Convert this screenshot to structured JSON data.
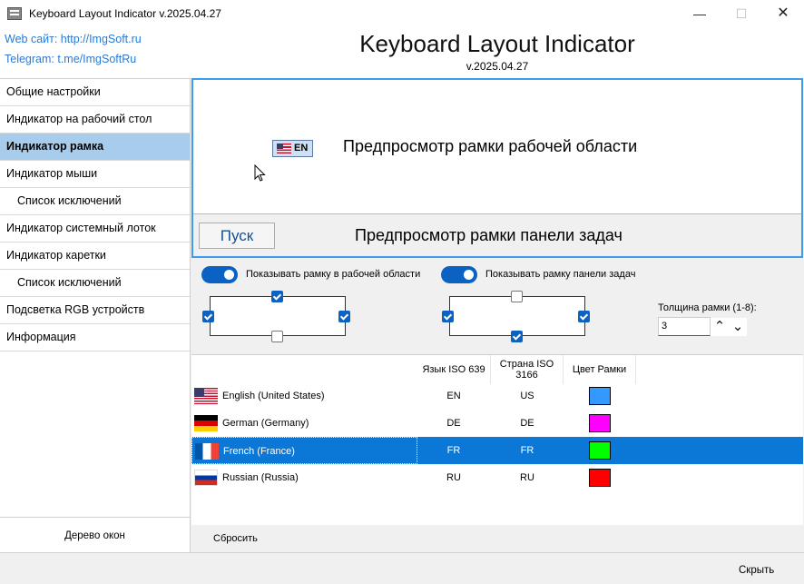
{
  "window": {
    "title": "Keyboard Layout Indicator v.2025.04.27",
    "minimize": "—",
    "maximize": "☐",
    "close": "✕"
  },
  "header": {
    "web_link": "Web сайт: http://ImgSoft.ru",
    "telegram_link": "Telegram: t.me/ImgSoftRu",
    "title": "Keyboard Layout Indicator",
    "version": "v.2025.04.27"
  },
  "sidebar": {
    "items": [
      {
        "label": "Общие настройки"
      },
      {
        "label": "Индикатор на рабочий стол"
      },
      {
        "label": "Индикатор рамка"
      },
      {
        "label": "Индикатор мыши"
      },
      {
        "label": "Список исключений"
      },
      {
        "label": "Индикатор системный лоток"
      },
      {
        "label": "Индикатор каретки"
      },
      {
        "label": "Список исключений"
      },
      {
        "label": "Подсветка RGB устройств"
      },
      {
        "label": "Информация"
      }
    ],
    "active_index": 2,
    "tree_button": "Дерево окон"
  },
  "preview": {
    "workspace_label": "Предпросмотр рамки рабочей области",
    "badge_text": "EN",
    "start_button": "Пуск",
    "taskbar_label": "Предпросмотр рамки панели задач"
  },
  "options": {
    "show_workspace_frame": {
      "label": "Показывать рамку в рабочей области",
      "on": true
    },
    "show_taskbar_frame": {
      "label": "Показывать рамку панели задач",
      "on": true
    },
    "workspace_sides": {
      "top": true,
      "left": true,
      "right": true,
      "bottom": false
    },
    "taskbar_sides": {
      "top": false,
      "left": true,
      "right": true,
      "bottom": true
    },
    "thickness_label": "Толщина рамки (1-8):",
    "thickness_value": "3"
  },
  "table": {
    "columns": {
      "iso639": "Язык ISO 639",
      "iso3166": "Страна ISO 3166",
      "color": "Цвет Рамки"
    },
    "rows": [
      {
        "name": "English (United States)",
        "iso639": "EN",
        "iso3166": "US",
        "color": "#3399ff",
        "flag": "us-flag"
      },
      {
        "name": "German (Germany)",
        "iso639": "DE",
        "iso3166": "DE",
        "color": "#ff00ff",
        "flag": "de-flag"
      },
      {
        "name": "French (France)",
        "iso639": "FR",
        "iso3166": "FR",
        "color": "#00ff00",
        "flag": "fr-flag"
      },
      {
        "name": "Russian (Russia)",
        "iso639": "RU",
        "iso3166": "RU",
        "color": "#ff0000",
        "flag": "ru-flag"
      }
    ],
    "selected_index": 2
  },
  "footer": {
    "reset": "Сбросить",
    "close": "Скрыть"
  }
}
